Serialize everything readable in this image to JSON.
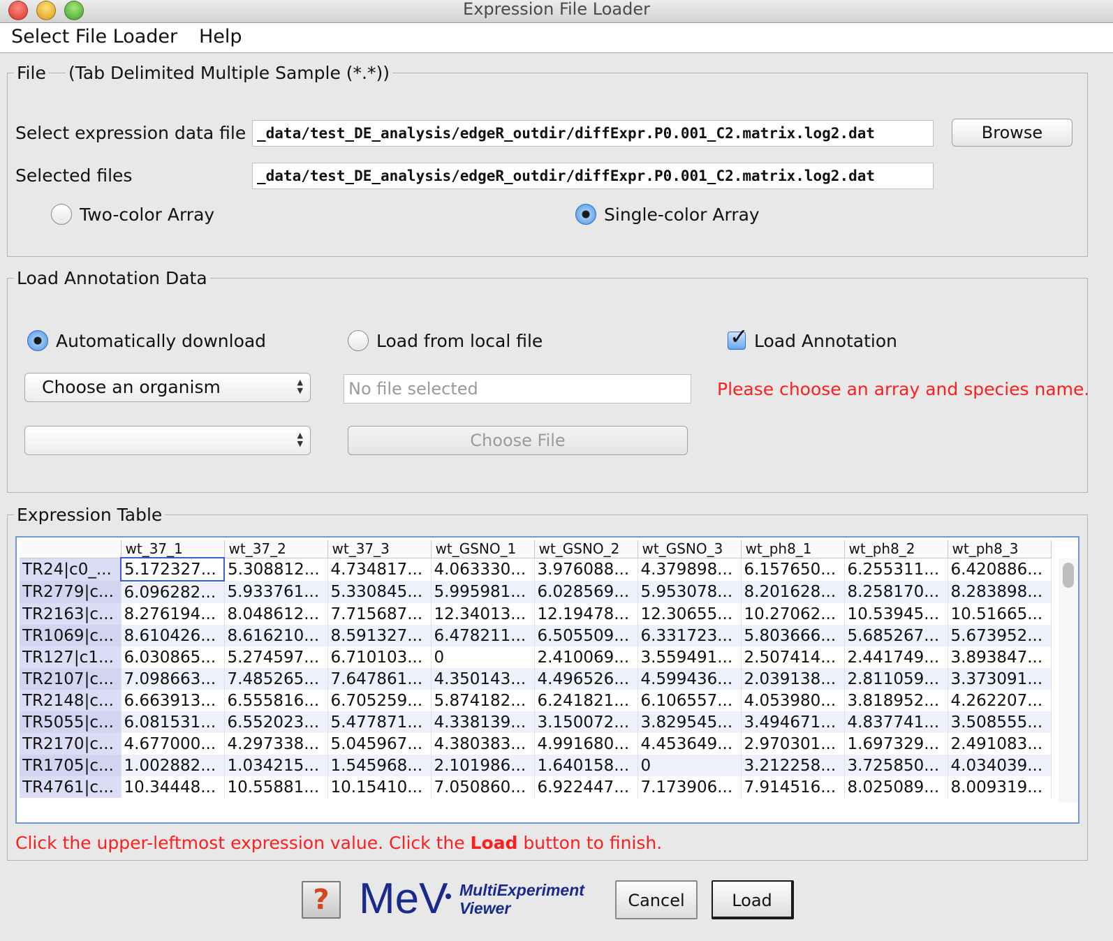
{
  "window": {
    "title": "Expression File Loader"
  },
  "menu": {
    "items": [
      "Select File Loader",
      "Help"
    ]
  },
  "file_panel": {
    "legend_file": "File",
    "legend_type": "(Tab Delimited Multiple Sample (*.*))",
    "select_label": "Select expression data file",
    "select_value": "_data/test_DE_analysis/edgeR_outdir/diffExpr.P0.001_C2.matrix.log2.dat",
    "browse_label": "Browse",
    "selected_label": "Selected files",
    "selected_value": "_data/test_DE_analysis/edgeR_outdir/diffExpr.P0.001_C2.matrix.log2.dat",
    "two_color_label": "Two-color Array",
    "single_color_label": "Single-color Array",
    "single_color_selected": true
  },
  "annotation_panel": {
    "legend": "Load Annotation Data",
    "auto_label": "Automatically download",
    "auto_selected": true,
    "local_label": "Load from local file",
    "load_annotation_label": "Load Annotation",
    "load_annotation_checked": true,
    "organism_value": "Choose an organism",
    "array_value": "",
    "file_placeholder": "No file selected",
    "choose_file_label": "Choose File",
    "warning": "Please choose an array and species name."
  },
  "expression_table": {
    "legend": "Expression Table",
    "columns": [
      "",
      "wt_37_1",
      "wt_37_2",
      "wt_37_3",
      "wt_GSNO_1",
      "wt_GSNO_2",
      "wt_GSNO_3",
      "wt_ph8_1",
      "wt_ph8_2",
      "wt_ph8_3"
    ],
    "rows": [
      [
        "TR24|c0_...",
        "5.172327...",
        "5.308812...",
        "4.734817...",
        "4.063330...",
        "3.976088...",
        "4.379898...",
        "6.157650...",
        "6.255311...",
        "6.420886..."
      ],
      [
        "TR2779|c...",
        "6.096282...",
        "5.933761...",
        "5.330845...",
        "5.995981...",
        "6.028569...",
        "5.953078...",
        "8.201628...",
        "8.258170...",
        "8.283898..."
      ],
      [
        "TR2163|c...",
        "8.276194...",
        "8.048612...",
        "7.715687...",
        "12.34013...",
        "12.19478...",
        "12.30655...",
        "10.27062...",
        "10.53945...",
        "10.51665..."
      ],
      [
        "TR1069|c...",
        "8.610426...",
        "8.616210...",
        "8.591327...",
        "6.478211...",
        "6.505509...",
        "6.331723...",
        "5.803666...",
        "5.685267...",
        "5.673952..."
      ],
      [
        "TR127|c1...",
        "6.030865...",
        "5.274597...",
        "6.710103...",
        "0",
        "2.410069...",
        "3.559491...",
        "2.507414...",
        "2.441749...",
        "3.893847..."
      ],
      [
        "TR2107|c...",
        "7.098663...",
        "7.485265...",
        "7.647861...",
        "4.350143...",
        "4.496526...",
        "4.599436...",
        "2.039138...",
        "2.811059...",
        "3.373091..."
      ],
      [
        "TR2148|c...",
        "6.663913...",
        "6.555816...",
        "6.705259...",
        "5.874182...",
        "6.241821...",
        "6.106557...",
        "4.053980...",
        "3.818952...",
        "4.262207..."
      ],
      [
        "TR5055|c...",
        "6.081531...",
        "6.552023...",
        "5.477871...",
        "4.338139...",
        "3.150072...",
        "3.829545...",
        "3.494671...",
        "4.837741...",
        "3.508555..."
      ],
      [
        "TR2170|c...",
        "4.677000...",
        "4.297338...",
        "5.045967...",
        "4.380383...",
        "4.991680...",
        "4.453649...",
        "2.970301...",
        "1.697329...",
        "2.491083..."
      ],
      [
        "TR1705|c...",
        "1.002882...",
        "1.034215...",
        "1.545968...",
        "2.101986...",
        "1.640158...",
        "0",
        "3.212258...",
        "3.725850...",
        "4.034039..."
      ],
      [
        "TR4761|c...",
        "10.34448...",
        "10.55881...",
        "10.15410...",
        "7.050860...",
        "6.922447...",
        "7.173906...",
        "7.914516...",
        "8.025089...",
        "8.009319..."
      ]
    ],
    "instruction_pre": "Click the upper-leftmost expression value. Click the ",
    "instruction_bold": "Load",
    "instruction_post": " button to finish."
  },
  "footer": {
    "help_glyph": "?",
    "logo_text": "MeV",
    "logo_sub1": "MultiExperiment",
    "logo_sub2": "Viewer",
    "cancel_label": "Cancel",
    "load_label": "Load"
  },
  "colors": {
    "warning": "#ff1e1e",
    "logo": "#1a2a8c",
    "accent": "#2a6fcf"
  }
}
